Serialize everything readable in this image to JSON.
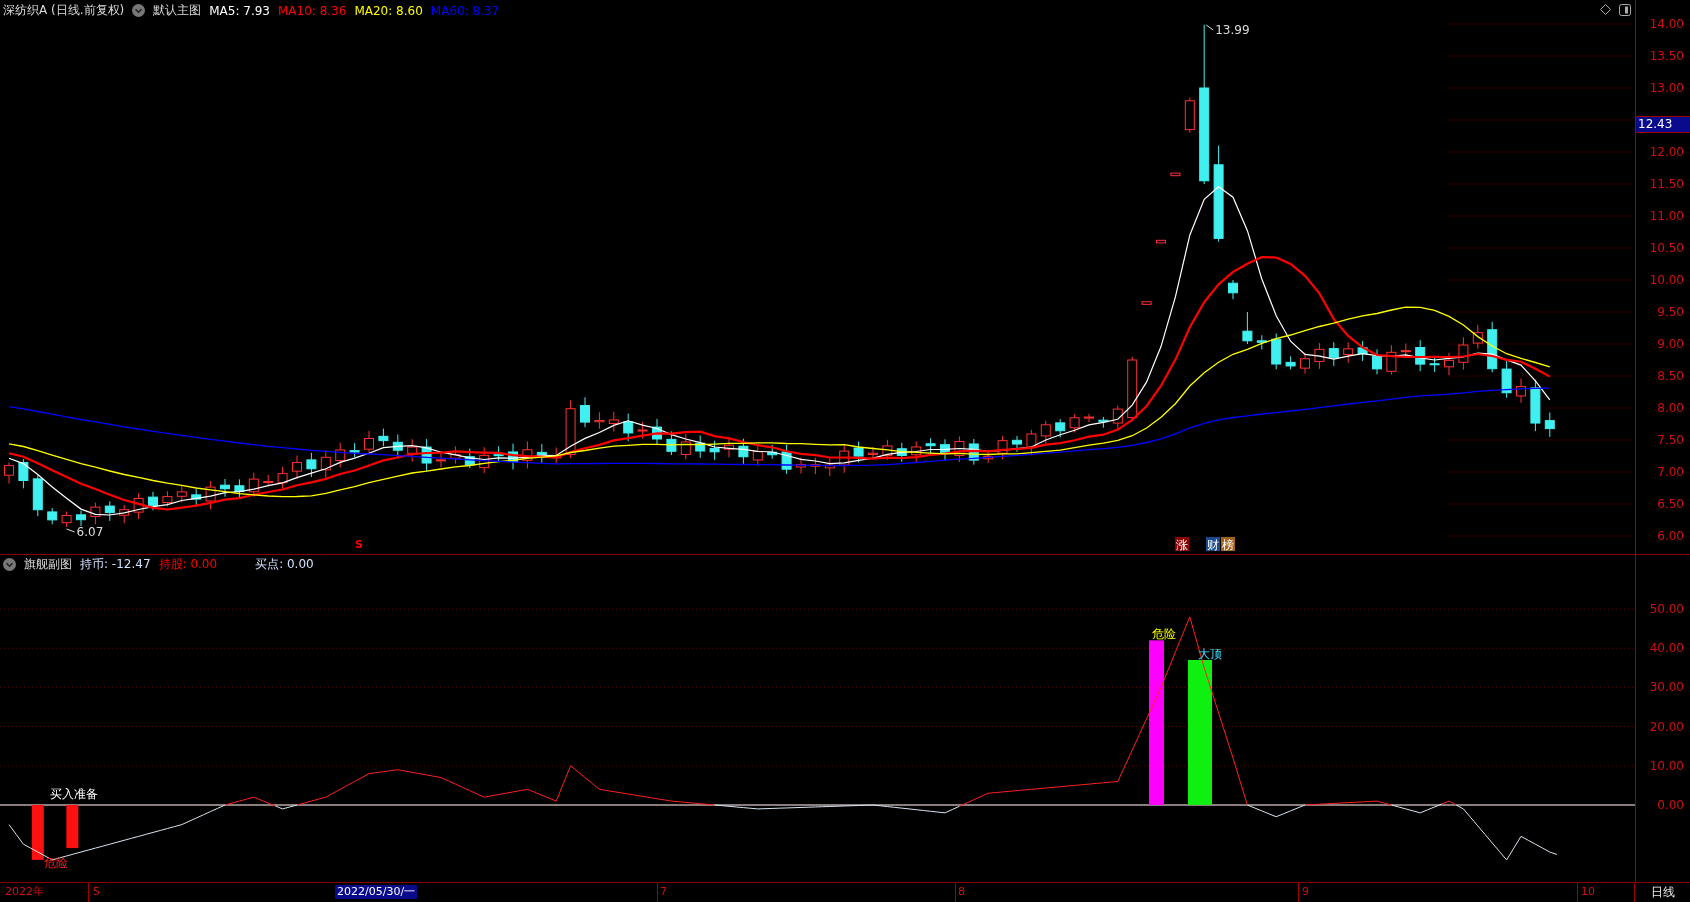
{
  "header": {
    "title": "深纺织A (日线.前复权)",
    "chart_name": "默认主图",
    "indicators": [
      {
        "label": "MA5: 7.93",
        "color": "#ffffff"
      },
      {
        "label": "MA10: 8.36",
        "color": "#ff0000"
      },
      {
        "label": "MA20: 8.60",
        "color": "#ffff00"
      },
      {
        "label": "MA60: 8.37",
        "color": "#0000ff"
      }
    ]
  },
  "main_chart": {
    "high_label": "13.99",
    "low_label": "6.07",
    "signals": [
      {
        "text": "S",
        "kind": "letter",
        "color": "#ff0000"
      },
      {
        "text": "涨",
        "kind": "tag",
        "color": "#8b0000"
      },
      {
        "text": "财",
        "kind": "tag",
        "color": "#1a4a8c"
      },
      {
        "text": "榜",
        "kind": "tag",
        "color": "#a0601a"
      }
    ]
  },
  "price_axis": {
    "ticks": [
      "14.00",
      "13.50",
      "13.00",
      "12.00",
      "11.50",
      "11.00",
      "10.50",
      "10.00",
      "9.50",
      "9.00",
      "8.50",
      "8.00",
      "7.50",
      "7.00",
      "6.50",
      "6.00"
    ],
    "current": "12.43"
  },
  "sub_header": {
    "title": "旗舰副图",
    "indicators": [
      {
        "label": "持币: -12.47",
        "color": "#d0e0ff"
      },
      {
        "label": "持股: 0.00",
        "color": "#ff0000"
      },
      {
        "label": "买点: 0.00",
        "color": "#d0e0ff"
      }
    ]
  },
  "sub_chart": {
    "labels": [
      {
        "text": "买入准备",
        "kind": "buy"
      },
      {
        "text": "危险",
        "kind": "low"
      },
      {
        "text": "危险",
        "kind": "danger"
      },
      {
        "text": "大顶",
        "kind": "top"
      }
    ]
  },
  "sub_axis": {
    "ticks": [
      "50.00",
      "40.00",
      "30.00",
      "20.00",
      "10.00",
      "0.00"
    ]
  },
  "time_axis": {
    "labels": [
      {
        "text": "2022年",
        "selected": false
      },
      {
        "text": "5",
        "selected": false
      },
      {
        "text": "2022/05/30/一",
        "selected": true
      },
      {
        "text": "7",
        "selected": false
      },
      {
        "text": "8",
        "selected": false
      },
      {
        "text": "9",
        "selected": false
      },
      {
        "text": "10",
        "selected": false
      }
    ],
    "period": "日线"
  }
}
